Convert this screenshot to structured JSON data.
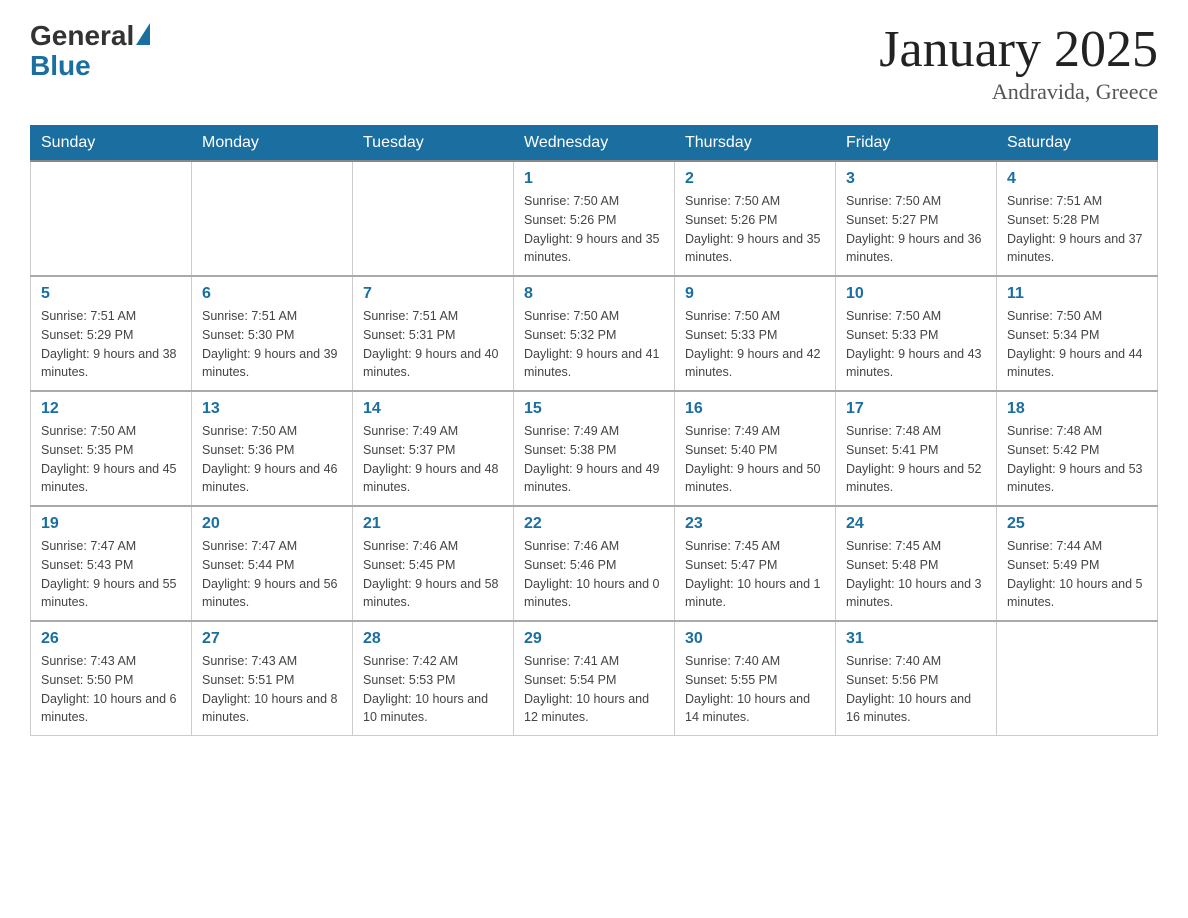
{
  "header": {
    "logo_general": "General",
    "logo_blue": "Blue",
    "month_title": "January 2025",
    "location": "Andravida, Greece"
  },
  "days_of_week": [
    "Sunday",
    "Monday",
    "Tuesday",
    "Wednesday",
    "Thursday",
    "Friday",
    "Saturday"
  ],
  "weeks": [
    [
      {
        "day": "",
        "info": ""
      },
      {
        "day": "",
        "info": ""
      },
      {
        "day": "",
        "info": ""
      },
      {
        "day": "1",
        "info": "Sunrise: 7:50 AM\nSunset: 5:26 PM\nDaylight: 9 hours and 35 minutes."
      },
      {
        "day": "2",
        "info": "Sunrise: 7:50 AM\nSunset: 5:26 PM\nDaylight: 9 hours and 35 minutes."
      },
      {
        "day": "3",
        "info": "Sunrise: 7:50 AM\nSunset: 5:27 PM\nDaylight: 9 hours and 36 minutes."
      },
      {
        "day": "4",
        "info": "Sunrise: 7:51 AM\nSunset: 5:28 PM\nDaylight: 9 hours and 37 minutes."
      }
    ],
    [
      {
        "day": "5",
        "info": "Sunrise: 7:51 AM\nSunset: 5:29 PM\nDaylight: 9 hours and 38 minutes."
      },
      {
        "day": "6",
        "info": "Sunrise: 7:51 AM\nSunset: 5:30 PM\nDaylight: 9 hours and 39 minutes."
      },
      {
        "day": "7",
        "info": "Sunrise: 7:51 AM\nSunset: 5:31 PM\nDaylight: 9 hours and 40 minutes."
      },
      {
        "day": "8",
        "info": "Sunrise: 7:50 AM\nSunset: 5:32 PM\nDaylight: 9 hours and 41 minutes."
      },
      {
        "day": "9",
        "info": "Sunrise: 7:50 AM\nSunset: 5:33 PM\nDaylight: 9 hours and 42 minutes."
      },
      {
        "day": "10",
        "info": "Sunrise: 7:50 AM\nSunset: 5:33 PM\nDaylight: 9 hours and 43 minutes."
      },
      {
        "day": "11",
        "info": "Sunrise: 7:50 AM\nSunset: 5:34 PM\nDaylight: 9 hours and 44 minutes."
      }
    ],
    [
      {
        "day": "12",
        "info": "Sunrise: 7:50 AM\nSunset: 5:35 PM\nDaylight: 9 hours and 45 minutes."
      },
      {
        "day": "13",
        "info": "Sunrise: 7:50 AM\nSunset: 5:36 PM\nDaylight: 9 hours and 46 minutes."
      },
      {
        "day": "14",
        "info": "Sunrise: 7:49 AM\nSunset: 5:37 PM\nDaylight: 9 hours and 48 minutes."
      },
      {
        "day": "15",
        "info": "Sunrise: 7:49 AM\nSunset: 5:38 PM\nDaylight: 9 hours and 49 minutes."
      },
      {
        "day": "16",
        "info": "Sunrise: 7:49 AM\nSunset: 5:40 PM\nDaylight: 9 hours and 50 minutes."
      },
      {
        "day": "17",
        "info": "Sunrise: 7:48 AM\nSunset: 5:41 PM\nDaylight: 9 hours and 52 minutes."
      },
      {
        "day": "18",
        "info": "Sunrise: 7:48 AM\nSunset: 5:42 PM\nDaylight: 9 hours and 53 minutes."
      }
    ],
    [
      {
        "day": "19",
        "info": "Sunrise: 7:47 AM\nSunset: 5:43 PM\nDaylight: 9 hours and 55 minutes."
      },
      {
        "day": "20",
        "info": "Sunrise: 7:47 AM\nSunset: 5:44 PM\nDaylight: 9 hours and 56 minutes."
      },
      {
        "day": "21",
        "info": "Sunrise: 7:46 AM\nSunset: 5:45 PM\nDaylight: 9 hours and 58 minutes."
      },
      {
        "day": "22",
        "info": "Sunrise: 7:46 AM\nSunset: 5:46 PM\nDaylight: 10 hours and 0 minutes."
      },
      {
        "day": "23",
        "info": "Sunrise: 7:45 AM\nSunset: 5:47 PM\nDaylight: 10 hours and 1 minute."
      },
      {
        "day": "24",
        "info": "Sunrise: 7:45 AM\nSunset: 5:48 PM\nDaylight: 10 hours and 3 minutes."
      },
      {
        "day": "25",
        "info": "Sunrise: 7:44 AM\nSunset: 5:49 PM\nDaylight: 10 hours and 5 minutes."
      }
    ],
    [
      {
        "day": "26",
        "info": "Sunrise: 7:43 AM\nSunset: 5:50 PM\nDaylight: 10 hours and 6 minutes."
      },
      {
        "day": "27",
        "info": "Sunrise: 7:43 AM\nSunset: 5:51 PM\nDaylight: 10 hours and 8 minutes."
      },
      {
        "day": "28",
        "info": "Sunrise: 7:42 AM\nSunset: 5:53 PM\nDaylight: 10 hours and 10 minutes."
      },
      {
        "day": "29",
        "info": "Sunrise: 7:41 AM\nSunset: 5:54 PM\nDaylight: 10 hours and 12 minutes."
      },
      {
        "day": "30",
        "info": "Sunrise: 7:40 AM\nSunset: 5:55 PM\nDaylight: 10 hours and 14 minutes."
      },
      {
        "day": "31",
        "info": "Sunrise: 7:40 AM\nSunset: 5:56 PM\nDaylight: 10 hours and 16 minutes."
      },
      {
        "day": "",
        "info": ""
      }
    ]
  ]
}
